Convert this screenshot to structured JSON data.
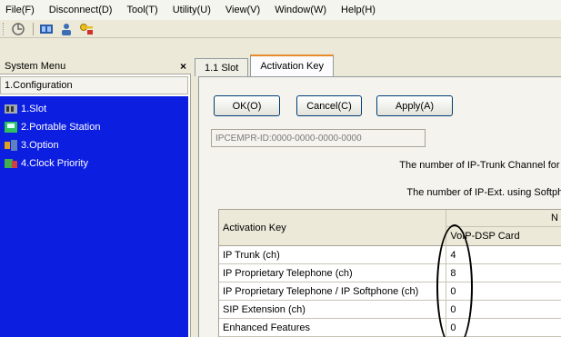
{
  "menubar": {
    "items": [
      "File(F)",
      "Disconnect(D)",
      "Tool(T)",
      "Utility(U)",
      "View(V)",
      "Window(W)",
      "Help(H)"
    ]
  },
  "toolbar": {
    "icons": [
      "connect-icon",
      "slot-view-icon",
      "user-icon",
      "key-icon"
    ]
  },
  "left_panel": {
    "title": "System Menu",
    "close_glyph": "×",
    "section": "1.Configuration",
    "items": [
      {
        "label": "1.Slot",
        "icon": "slot-icon"
      },
      {
        "label": "2.Portable Station",
        "icon": "portable-station-icon"
      },
      {
        "label": "3.Option",
        "icon": "option-icon"
      },
      {
        "label": "4.Clock Priority",
        "icon": "clock-priority-icon"
      }
    ]
  },
  "tabs": [
    {
      "label": "1.1 Slot",
      "active": false
    },
    {
      "label": "Activation Key",
      "active": true
    }
  ],
  "buttons": {
    "ok": "OK(O)",
    "cancel": "Cancel(C)",
    "apply": "Apply(A)"
  },
  "id_field": "IPCEMPR-ID:0000-0000-0000-0000",
  "info": {
    "line1": "The number of IP-Trunk Channel for IP",
    "line2": "The number of IP-Ext. using Softphor"
  },
  "table": {
    "header_key": "Activation Key",
    "header_group": "N",
    "header_sub": "VoIP-DSP Card",
    "rows": [
      {
        "key": "IP Trunk (ch)",
        "value": "4"
      },
      {
        "key": "IP Proprietary Telephone (ch)",
        "value": "8"
      },
      {
        "key": "IP Proprietary Telephone / IP Softphone (ch)",
        "value": "0"
      },
      {
        "key": "SIP Extension (ch)",
        "value": "0"
      },
      {
        "key": "Enhanced Features",
        "value": "0"
      }
    ]
  },
  "colors": {
    "tree_bg": "#0c1ee0",
    "tab_active_accent": "#e68b2c",
    "button_border": "#003c74"
  }
}
